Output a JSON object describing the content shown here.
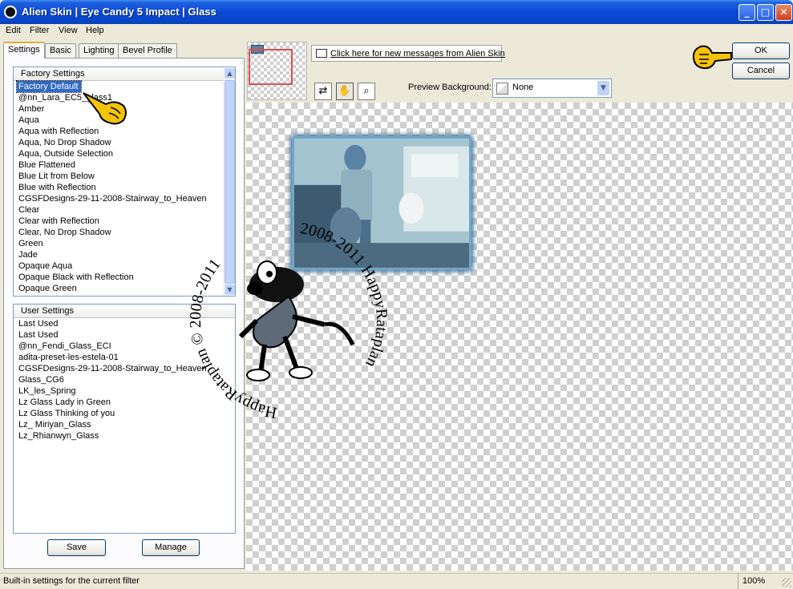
{
  "window": {
    "title": "Alien Skin | Eye Candy 5 Impact | Glass",
    "minimize_glyph": "_",
    "maximize_glyph": "□",
    "close_glyph": "✕"
  },
  "menu": [
    "Edit",
    "Filter",
    "View",
    "Help"
  ],
  "tabs": [
    "Settings",
    "Basic",
    "Lighting",
    "Bevel Profile"
  ],
  "factory_settings": {
    "header": "Factory Settings",
    "selected": "Factory Default",
    "items": [
      "@nn_Lara_EC5_glass1",
      "Amber",
      "Aqua",
      "Aqua with Reflection",
      "Aqua, No Drop Shadow",
      "Aqua, Outside Selection",
      "Blue Flattened",
      "Blue Lit from Below",
      "Blue with Reflection",
      "CGSFDesigns-29-11-2008-Stairway_to_Heaven",
      "Clear",
      "Clear with Reflection",
      "Clear, No Drop Shadow",
      "Green",
      "Jade",
      "Opaque Aqua",
      "Opaque Black with Reflection",
      "Opaque Green"
    ]
  },
  "user_settings": {
    "header": "User Settings",
    "items": [
      "Last Used",
      "Last Used",
      "@nn_Fendi_Glass_ECI",
      "adita-preset-les-estela-01",
      "CGSFDesigns-29-11-2008-Stairway_to_Heaven",
      "Glass_CG6",
      "LK_les_Spring",
      "Lz Glass Lady in Green",
      "Lz Glass Thinking of you",
      "Lz_ Miriyan_Glass",
      "Lz_Rhianwyn_Glass"
    ]
  },
  "buttons": {
    "save": "Save",
    "manage": "Manage",
    "ok": "OK",
    "cancel": "Cancel"
  },
  "messages_link": "Click here for new messages from Alien Skin",
  "preview_background": {
    "label": "Preview Background:",
    "value": "None"
  },
  "watermark": {
    "text_top": "2008-2011 HappyRataplan",
    "text_bottom": "HappyRataplan © 2008-2011",
    "copyright": "©"
  },
  "status": {
    "text": "Built-in settings for the current filter",
    "zoom": "100%"
  },
  "colors": {
    "titlebar": "#0a49d8",
    "selection": "#316ac5",
    "pointer_hand": "#f5c400"
  }
}
